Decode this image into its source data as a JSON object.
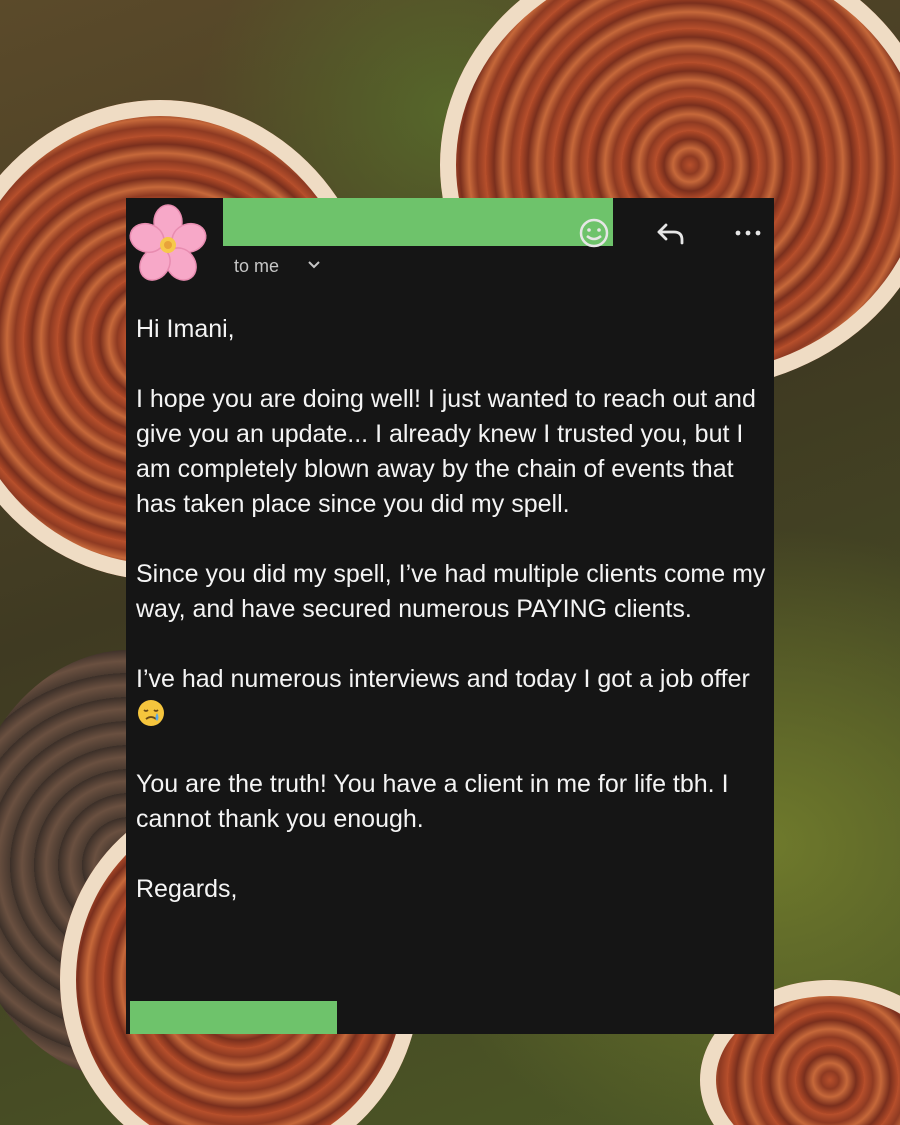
{
  "email": {
    "recipient_label": "to me",
    "greeting": "Hi Imani,",
    "paragraphs": [
      "I hope you are doing well! I just wanted to reach out and give you an update... I already knew I trusted you, but I am completely blown away by the chain of events that has taken place since you did my spell.",
      "Since you did my spell, I’ve had multiple clients come my way, and have secured numerous PAYING clients.",
      "I’ve had numerous interviews and today I got a job offer",
      "You are the truth! You have a client in me for life tbh. I cannot thank you enough."
    ],
    "closing": "Regards,",
    "avatar_icon": "cherry-blossom-icon",
    "toolbar_icons": [
      "emoji-react-icon",
      "reply-icon",
      "more-options-icon"
    ],
    "inline_emoji": "crying-face-emoji",
    "redaction_color": "#6ec36b",
    "card_background": "#151515"
  }
}
